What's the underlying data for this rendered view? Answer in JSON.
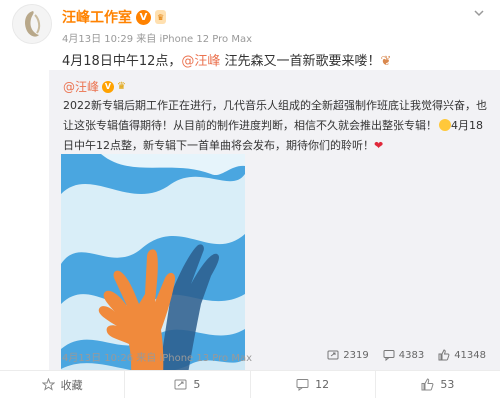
{
  "post": {
    "author": "汪峰工作室",
    "verified_icon": "verified-v-icon",
    "vip_badge": "vip-badge-icon",
    "timestamp": "4月13日 10:29",
    "source": "来自 iPhone 12 Pro Max",
    "text_prefix": "4月18日中午12点，",
    "text_mention": "@汪峰",
    "text_suffix": " 汪先森又一首新歌要来喽！",
    "text_emoji": "❦",
    "more_icon": "chevron-down-icon"
  },
  "repost": {
    "author": "@汪峰",
    "text_part1": "2022新专辑后期工作正在进行，几代音乐人组成的全新超强制作班底让我觉得兴奋，也让这张专辑值得期待！从目前的制作进度判断，相信不久就会推出整张专辑！",
    "text_part2": "4月18日中午12点整，新专辑下一首单曲将会发布，期待你们的聆听！",
    "heart": "❤",
    "image_alt": "hand-sky-artwork",
    "timestamp": "4月13日 10:26",
    "source": "来自 iPhone 13 Pro Max",
    "reposts": "2319",
    "comments": "4383",
    "likes": "41348"
  },
  "actions": {
    "favorite": "收藏",
    "repost": "5",
    "comment": "12",
    "like": "53"
  },
  "colors": {
    "brand_orange": "#ff8200",
    "mention": "#eb7350",
    "sky_blue": "#4aa6e0",
    "hand_orange": "#f08a3c"
  }
}
